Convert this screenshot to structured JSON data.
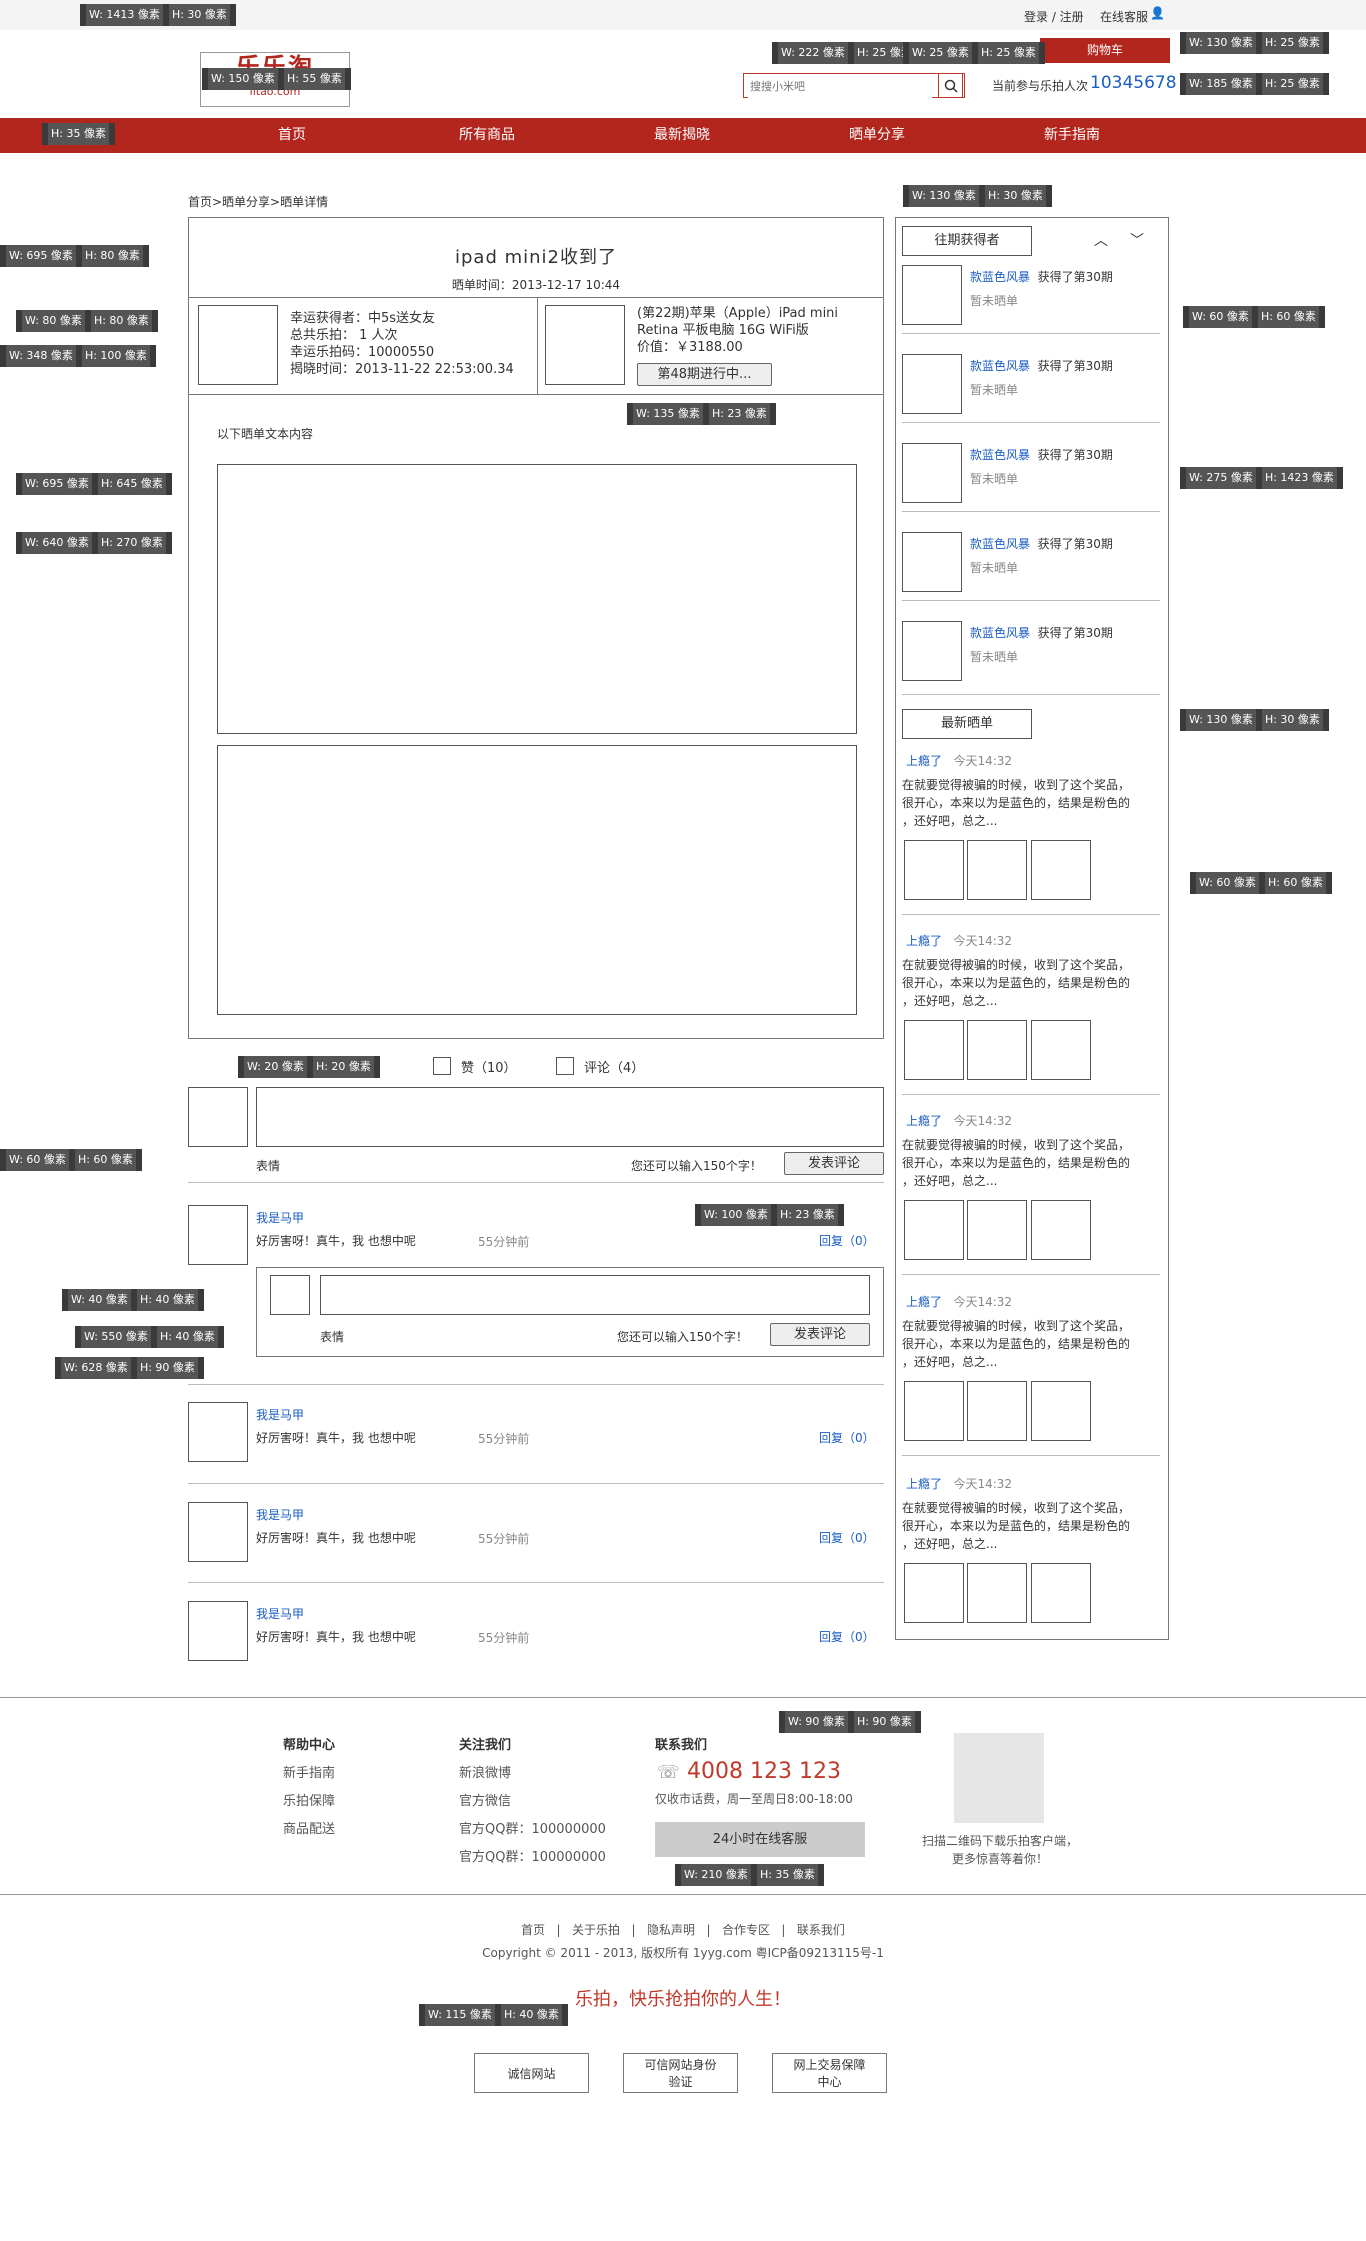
{
  "topbar": {
    "login": "登录 / 注册",
    "service": "在线客服",
    "cart": "购物车"
  },
  "logo": {
    "text": "乐乐淘",
    "domain": "lltao.com"
  },
  "search": {
    "placeholder": "搜搜小米吧"
  },
  "counter": {
    "label": "当前参与乐拍人次",
    "value": "10345678"
  },
  "nav": [
    "首页",
    "所有商品",
    "最新揭晓",
    "晒单分享",
    "新手指南"
  ],
  "breadcrumb": "首页>晒单分享>晒单详情",
  "post": {
    "title": "ipad mini2收到了",
    "time": "晒单时间：2013-12-17 10:44",
    "winner": "幸运获得者：中5s送女友",
    "times": "总共乐拍：  1  人次",
    "code": "幸运乐拍码：10000550",
    "reveal": "揭晓时间：2013-11-22 22:53:00.34",
    "product": "(第22期)苹果（Apple）iPad mini Retina 平板电脑 16G WiFi版",
    "price": "价值：￥3188.00",
    "period_btn": "第48期进行中...",
    "content_label": "以下晒单文本内容"
  },
  "actions": {
    "like": "赞（10）",
    "comment": "评论（4）"
  },
  "comment_box": {
    "emoji": "表情",
    "hint": "您还可以输入150个字！",
    "submit": "发表评论"
  },
  "comments": [
    {
      "user": "我是马甲",
      "text": "好厉害呀！真牛，我 也想中呢",
      "time": "55分钟前",
      "reply": "回复（0）"
    },
    {
      "user": "我是马甲",
      "text": "好厉害呀！真牛，我 也想中呢",
      "time": "55分钟前",
      "reply": "回复（0）"
    },
    {
      "user": "我是马甲",
      "text": "好厉害呀！真牛，我 也想中呢",
      "time": "55分钟前",
      "reply": "回复（0）"
    },
    {
      "user": "我是马甲",
      "text": "好厉害呀！真牛，我 也想中呢",
      "time": "55分钟前",
      "reply": "回复（0）"
    }
  ],
  "sidebar": {
    "past_title": "往期获得者",
    "past": [
      {
        "user": "款蓝色风暴",
        "desc": "获得了第30期",
        "status": "暂未晒单"
      },
      {
        "user": "款蓝色风暴",
        "desc": "获得了第30期",
        "status": "暂未晒单"
      },
      {
        "user": "款蓝色风暴",
        "desc": "获得了第30期",
        "status": "暂未晒单"
      },
      {
        "user": "款蓝色风暴",
        "desc": "获得了第30期",
        "status": "暂未晒单"
      },
      {
        "user": "款蓝色风暴",
        "desc": "获得了第30期",
        "status": "暂未晒单"
      }
    ],
    "latest_title": "最新晒单",
    "latest": [
      {
        "user": "上瘾了",
        "time": "今天14:32",
        "text1": "在就要觉得被骗的时候，收到了这个奖品，",
        "text2": "很开心，本来以为是蓝色的，结果是粉色的",
        "text3": "，还好吧，总之..."
      },
      {
        "user": "上瘾了",
        "time": "今天14:32",
        "text1": "在就要觉得被骗的时候，收到了这个奖品，",
        "text2": "很开心，本来以为是蓝色的，结果是粉色的",
        "text3": "，还好吧，总之..."
      },
      {
        "user": "上瘾了",
        "time": "今天14:32",
        "text1": "在就要觉得被骗的时候，收到了这个奖品，",
        "text2": "很开心，本来以为是蓝色的，结果是粉色的",
        "text3": "，还好吧，总之..."
      },
      {
        "user": "上瘾了",
        "time": "今天14:32",
        "text1": "在就要觉得被骗的时候，收到了这个奖品，",
        "text2": "很开心，本来以为是蓝色的，结果是粉色的",
        "text3": "，还好吧，总之..."
      },
      {
        "user": "上瘾了",
        "time": "今天14:32",
        "text1": "在就要觉得被骗的时候，收到了这个奖品，",
        "text2": "很开心，本来以为是蓝色的，结果是粉色的",
        "text3": "，还好吧，总之..."
      }
    ]
  },
  "footer": {
    "help": {
      "title": "帮助中心",
      "links": [
        "新手指南",
        "乐拍保障",
        "商品配送"
      ]
    },
    "follow": {
      "title": "关注我们",
      "links": [
        "新浪微博",
        "官方微信",
        "官方QQ群：100000000",
        "官方QQ群：100000000"
      ]
    },
    "contact": {
      "title": "联系我们",
      "phone": "4008 123 123",
      "note": "仅收市话费，周一至周日8:00-18:00",
      "service_btn": "24小时在线客服"
    },
    "qr_note1": "扫描二维码下载乐拍客户端，",
    "qr_note2": "更多惊喜等着你！",
    "bottom_links": [
      "首页",
      "关于乐拍",
      "隐私声明",
      "合作专区",
      "联系我们"
    ],
    "separator": "|",
    "copyright": "Copyright © 2011 - 2013, 版权所有 1yyg.com 粤ICP备09213115号-1",
    "slogan": "乐拍，快乐抢拍你的人生！",
    "badges": [
      "诚信网站",
      "可信网站身份验证",
      "网上交易保障中心"
    ]
  },
  "annotations": [
    "W: 1413 像素",
    "H: 30 像素",
    "W: 150 像素",
    "H: 55 像素",
    "W: 222 像素",
    "H: 25 像素",
    "W: 25 像素",
    "H: 25 像素",
    "W: 130 像素",
    "H: 25 像素",
    "W: 185 像素",
    "H: 25 像素",
    "H: 35 像素",
    "W: 130 像素",
    "H: 30 像素",
    "W: 695 像素",
    "H: 80 像素",
    "W: 80 像素",
    "H: 80 像素",
    "W: 348 像素",
    "H: 100 像素",
    "W: 60 像素",
    "H: 60 像素",
    "W: 135 像素",
    "H: 23 像素",
    "W: 695 像素",
    "H: 645 像素",
    "W: 275 像素",
    "H: 1423 像素",
    "W: 640 像素",
    "H: 270 像素",
    "W: 130 像素",
    "H: 30 像素",
    "W: 60 像素",
    "H: 60 像素",
    "W: 20 像素",
    "H: 20 像素",
    "W: 60 像素",
    "H: 60 像素",
    "W: 100 像素",
    "H: 23 像素",
    "W: 40 像素",
    "H: 40 像素",
    "W: 550 像素",
    "H: 40 像素",
    "W: 628 像素",
    "H: 90 像素",
    "W: 90 像素",
    "H: 90 像素",
    "W: 210 像素",
    "H: 35 像素",
    "W: 115 像素",
    "H: 40 像素"
  ]
}
